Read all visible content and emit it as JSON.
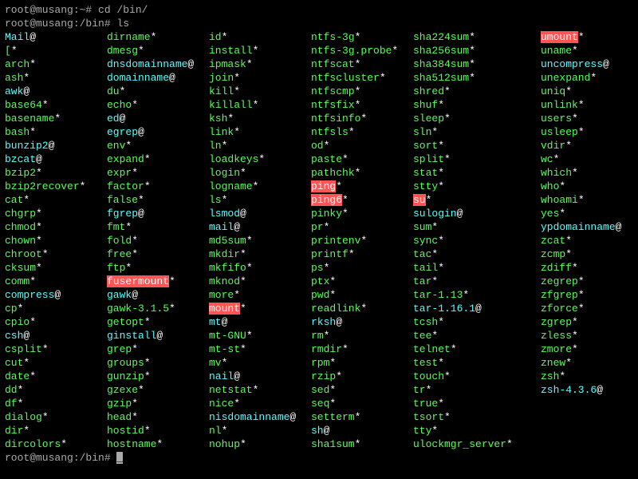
{
  "prompt1": "root@musang:~# ",
  "cmd1": "cd /bin/",
  "prompt2": "root@musang:/bin# ",
  "cmd2": "ls",
  "prompt3": "root@musang:/bin# ",
  "cursor": "_",
  "columns": [
    [
      {
        "name": "Mail",
        "suffix": "@",
        "style": "cyan"
      },
      {
        "name": "[",
        "suffix": "*",
        "style": "green"
      },
      {
        "name": "arch",
        "suffix": "*",
        "style": "green"
      },
      {
        "name": "ash",
        "suffix": "*",
        "style": "green"
      },
      {
        "name": "awk",
        "suffix": "@",
        "style": "cyan"
      },
      {
        "name": "base64",
        "suffix": "*",
        "style": "green"
      },
      {
        "name": "basename",
        "suffix": "*",
        "style": "green"
      },
      {
        "name": "bash",
        "suffix": "*",
        "style": "green"
      },
      {
        "name": "bunzip2",
        "suffix": "@",
        "style": "cyan"
      },
      {
        "name": "bzcat",
        "suffix": "@",
        "style": "cyan"
      },
      {
        "name": "bzip2",
        "suffix": "*",
        "style": "green"
      },
      {
        "name": "bzip2recover",
        "suffix": "*",
        "style": "green"
      },
      {
        "name": "cat",
        "suffix": "*",
        "style": "green"
      },
      {
        "name": "chgrp",
        "suffix": "*",
        "style": "green"
      },
      {
        "name": "chmod",
        "suffix": "*",
        "style": "green"
      },
      {
        "name": "chown",
        "suffix": "*",
        "style": "green"
      },
      {
        "name": "chroot",
        "suffix": "*",
        "style": "green"
      },
      {
        "name": "cksum",
        "suffix": "*",
        "style": "green"
      },
      {
        "name": "comm",
        "suffix": "*",
        "style": "green"
      },
      {
        "name": "compress",
        "suffix": "@",
        "style": "cyan"
      },
      {
        "name": "cp",
        "suffix": "*",
        "style": "green"
      },
      {
        "name": "cpio",
        "suffix": "*",
        "style": "green"
      },
      {
        "name": "csh",
        "suffix": "@",
        "style": "cyan"
      },
      {
        "name": "csplit",
        "suffix": "*",
        "style": "green"
      },
      {
        "name": "cut",
        "suffix": "*",
        "style": "green"
      },
      {
        "name": "date",
        "suffix": "*",
        "style": "green"
      },
      {
        "name": "dd",
        "suffix": "*",
        "style": "green"
      },
      {
        "name": "df",
        "suffix": "*",
        "style": "green"
      },
      {
        "name": "dialog",
        "suffix": "*",
        "style": "green"
      },
      {
        "name": "dir",
        "suffix": "*",
        "style": "green"
      },
      {
        "name": "dircolors",
        "suffix": "*",
        "style": "green"
      }
    ],
    [
      {
        "name": "dirname",
        "suffix": "*",
        "style": "green"
      },
      {
        "name": "dmesg",
        "suffix": "*",
        "style": "green"
      },
      {
        "name": "dnsdomainname",
        "suffix": "@",
        "style": "cyan"
      },
      {
        "name": "domainname",
        "suffix": "@",
        "style": "cyan"
      },
      {
        "name": "du",
        "suffix": "*",
        "style": "green"
      },
      {
        "name": "echo",
        "suffix": "*",
        "style": "green"
      },
      {
        "name": "ed",
        "suffix": "@",
        "style": "cyan"
      },
      {
        "name": "egrep",
        "suffix": "@",
        "style": "cyan"
      },
      {
        "name": "env",
        "suffix": "*",
        "style": "green"
      },
      {
        "name": "expand",
        "suffix": "*",
        "style": "green"
      },
      {
        "name": "expr",
        "suffix": "*",
        "style": "green"
      },
      {
        "name": "factor",
        "suffix": "*",
        "style": "green"
      },
      {
        "name": "false",
        "suffix": "*",
        "style": "green"
      },
      {
        "name": "fgrep",
        "suffix": "@",
        "style": "cyan"
      },
      {
        "name": "fmt",
        "suffix": "*",
        "style": "green"
      },
      {
        "name": "fold",
        "suffix": "*",
        "style": "green"
      },
      {
        "name": "free",
        "suffix": "*",
        "style": "green"
      },
      {
        "name": "ftp",
        "suffix": "*",
        "style": "green"
      },
      {
        "name": "fusermount",
        "suffix": "*",
        "style": "redbg"
      },
      {
        "name": "gawk",
        "suffix": "@",
        "style": "cyan"
      },
      {
        "name": "gawk-3.1.5",
        "suffix": "*",
        "style": "green"
      },
      {
        "name": "getopt",
        "suffix": "*",
        "style": "green"
      },
      {
        "name": "ginstall",
        "suffix": "@",
        "style": "cyan"
      },
      {
        "name": "grep",
        "suffix": "*",
        "style": "green"
      },
      {
        "name": "groups",
        "suffix": "*",
        "style": "green"
      },
      {
        "name": "gunzip",
        "suffix": "*",
        "style": "green"
      },
      {
        "name": "gzexe",
        "suffix": "*",
        "style": "green"
      },
      {
        "name": "gzip",
        "suffix": "*",
        "style": "green"
      },
      {
        "name": "head",
        "suffix": "*",
        "style": "green"
      },
      {
        "name": "hostid",
        "suffix": "*",
        "style": "green"
      },
      {
        "name": "hostname",
        "suffix": "*",
        "style": "green"
      }
    ],
    [
      {
        "name": "id",
        "suffix": "*",
        "style": "green"
      },
      {
        "name": "install",
        "suffix": "*",
        "style": "green"
      },
      {
        "name": "ipmask",
        "suffix": "*",
        "style": "green"
      },
      {
        "name": "join",
        "suffix": "*",
        "style": "green"
      },
      {
        "name": "kill",
        "suffix": "*",
        "style": "green"
      },
      {
        "name": "killall",
        "suffix": "*",
        "style": "green"
      },
      {
        "name": "ksh",
        "suffix": "*",
        "style": "green"
      },
      {
        "name": "link",
        "suffix": "*",
        "style": "green"
      },
      {
        "name": "ln",
        "suffix": "*",
        "style": "green"
      },
      {
        "name": "loadkeys",
        "suffix": "*",
        "style": "green"
      },
      {
        "name": "login",
        "suffix": "*",
        "style": "green"
      },
      {
        "name": "logname",
        "suffix": "*",
        "style": "green"
      },
      {
        "name": "ls",
        "suffix": "*",
        "style": "green"
      },
      {
        "name": "lsmod",
        "suffix": "@",
        "style": "cyan"
      },
      {
        "name": "mail",
        "suffix": "@",
        "style": "cyan"
      },
      {
        "name": "md5sum",
        "suffix": "*",
        "style": "green"
      },
      {
        "name": "mkdir",
        "suffix": "*",
        "style": "green"
      },
      {
        "name": "mkfifo",
        "suffix": "*",
        "style": "green"
      },
      {
        "name": "mknod",
        "suffix": "*",
        "style": "green"
      },
      {
        "name": "more",
        "suffix": "*",
        "style": "green"
      },
      {
        "name": "mount",
        "suffix": "*",
        "style": "redbg"
      },
      {
        "name": "mt",
        "suffix": "@",
        "style": "cyan"
      },
      {
        "name": "mt-GNU",
        "suffix": "*",
        "style": "green"
      },
      {
        "name": "mt-st",
        "suffix": "*",
        "style": "green"
      },
      {
        "name": "mv",
        "suffix": "*",
        "style": "green"
      },
      {
        "name": "nail",
        "suffix": "@",
        "style": "cyan"
      },
      {
        "name": "netstat",
        "suffix": "*",
        "style": "green"
      },
      {
        "name": "nice",
        "suffix": "*",
        "style": "green"
      },
      {
        "name": "nisdomainname",
        "suffix": "@",
        "style": "cyan"
      },
      {
        "name": "nl",
        "suffix": "*",
        "style": "green"
      },
      {
        "name": "nohup",
        "suffix": "*",
        "style": "green"
      }
    ],
    [
      {
        "name": "ntfs-3g",
        "suffix": "*",
        "style": "green"
      },
      {
        "name": "ntfs-3g.probe",
        "suffix": "*",
        "style": "green"
      },
      {
        "name": "ntfscat",
        "suffix": "*",
        "style": "green"
      },
      {
        "name": "ntfscluster",
        "suffix": "*",
        "style": "green"
      },
      {
        "name": "ntfscmp",
        "suffix": "*",
        "style": "green"
      },
      {
        "name": "ntfsfix",
        "suffix": "*",
        "style": "green"
      },
      {
        "name": "ntfsinfo",
        "suffix": "*",
        "style": "green"
      },
      {
        "name": "ntfsls",
        "suffix": "*",
        "style": "green"
      },
      {
        "name": "od",
        "suffix": "*",
        "style": "green"
      },
      {
        "name": "paste",
        "suffix": "*",
        "style": "green"
      },
      {
        "name": "pathchk",
        "suffix": "*",
        "style": "green"
      },
      {
        "name": "ping",
        "suffix": "*",
        "style": "redbg"
      },
      {
        "name": "ping6",
        "suffix": "*",
        "style": "redbg"
      },
      {
        "name": "pinky",
        "suffix": "*",
        "style": "green"
      },
      {
        "name": "pr",
        "suffix": "*",
        "style": "green"
      },
      {
        "name": "printenv",
        "suffix": "*",
        "style": "green"
      },
      {
        "name": "printf",
        "suffix": "*",
        "style": "green"
      },
      {
        "name": "ps",
        "suffix": "*",
        "style": "green"
      },
      {
        "name": "ptx",
        "suffix": "*",
        "style": "green"
      },
      {
        "name": "pwd",
        "suffix": "*",
        "style": "green"
      },
      {
        "name": "readlink",
        "suffix": "*",
        "style": "green"
      },
      {
        "name": "rksh",
        "suffix": "@",
        "style": "cyan"
      },
      {
        "name": "rm",
        "suffix": "*",
        "style": "green"
      },
      {
        "name": "rmdir",
        "suffix": "*",
        "style": "green"
      },
      {
        "name": "rpm",
        "suffix": "*",
        "style": "green"
      },
      {
        "name": "rzip",
        "suffix": "*",
        "style": "green"
      },
      {
        "name": "sed",
        "suffix": "*",
        "style": "green"
      },
      {
        "name": "seq",
        "suffix": "*",
        "style": "green"
      },
      {
        "name": "setterm",
        "suffix": "*",
        "style": "green"
      },
      {
        "name": "sh",
        "suffix": "@",
        "style": "cyan"
      },
      {
        "name": "sha1sum",
        "suffix": "*",
        "style": "green"
      }
    ],
    [
      {
        "name": "sha224sum",
        "suffix": "*",
        "style": "green"
      },
      {
        "name": "sha256sum",
        "suffix": "*",
        "style": "green"
      },
      {
        "name": "sha384sum",
        "suffix": "*",
        "style": "green"
      },
      {
        "name": "sha512sum",
        "suffix": "*",
        "style": "green"
      },
      {
        "name": "shred",
        "suffix": "*",
        "style": "green"
      },
      {
        "name": "shuf",
        "suffix": "*",
        "style": "green"
      },
      {
        "name": "sleep",
        "suffix": "*",
        "style": "green"
      },
      {
        "name": "sln",
        "suffix": "*",
        "style": "green"
      },
      {
        "name": "sort",
        "suffix": "*",
        "style": "green"
      },
      {
        "name": "split",
        "suffix": "*",
        "style": "green"
      },
      {
        "name": "stat",
        "suffix": "*",
        "style": "green"
      },
      {
        "name": "stty",
        "suffix": "*",
        "style": "green"
      },
      {
        "name": "su",
        "suffix": "*",
        "style": "redbg"
      },
      {
        "name": "sulogin",
        "suffix": "@",
        "style": "cyan"
      },
      {
        "name": "sum",
        "suffix": "*",
        "style": "green"
      },
      {
        "name": "sync",
        "suffix": "*",
        "style": "green"
      },
      {
        "name": "tac",
        "suffix": "*",
        "style": "green"
      },
      {
        "name": "tail",
        "suffix": "*",
        "style": "green"
      },
      {
        "name": "tar",
        "suffix": "*",
        "style": "green"
      },
      {
        "name": "tar-1.13",
        "suffix": "*",
        "style": "green"
      },
      {
        "name": "tar-1.16.1",
        "suffix": "@",
        "style": "cyan"
      },
      {
        "name": "tcsh",
        "suffix": "*",
        "style": "green"
      },
      {
        "name": "tee",
        "suffix": "*",
        "style": "green"
      },
      {
        "name": "telnet",
        "suffix": "*",
        "style": "green"
      },
      {
        "name": "test",
        "suffix": "*",
        "style": "green"
      },
      {
        "name": "touch",
        "suffix": "*",
        "style": "green"
      },
      {
        "name": "tr",
        "suffix": "*",
        "style": "green"
      },
      {
        "name": "true",
        "suffix": "*",
        "style": "green"
      },
      {
        "name": "tsort",
        "suffix": "*",
        "style": "green"
      },
      {
        "name": "tty",
        "suffix": "*",
        "style": "green"
      },
      {
        "name": "ulockmgr_server",
        "suffix": "*",
        "style": "green"
      }
    ],
    [
      {
        "name": "umount",
        "suffix": "*",
        "style": "redbg"
      },
      {
        "name": "uname",
        "suffix": "*",
        "style": "green"
      },
      {
        "name": "uncompress",
        "suffix": "@",
        "style": "cyan"
      },
      {
        "name": "unexpand",
        "suffix": "*",
        "style": "green"
      },
      {
        "name": "uniq",
        "suffix": "*",
        "style": "green"
      },
      {
        "name": "unlink",
        "suffix": "*",
        "style": "green"
      },
      {
        "name": "users",
        "suffix": "*",
        "style": "green"
      },
      {
        "name": "usleep",
        "suffix": "*",
        "style": "green"
      },
      {
        "name": "vdir",
        "suffix": "*",
        "style": "green"
      },
      {
        "name": "wc",
        "suffix": "*",
        "style": "green"
      },
      {
        "name": "which",
        "suffix": "*",
        "style": "green"
      },
      {
        "name": "who",
        "suffix": "*",
        "style": "green"
      },
      {
        "name": "whoami",
        "suffix": "*",
        "style": "green"
      },
      {
        "name": "yes",
        "suffix": "*",
        "style": "green"
      },
      {
        "name": "ypdomainname",
        "suffix": "@",
        "style": "cyan"
      },
      {
        "name": "zcat",
        "suffix": "*",
        "style": "green"
      },
      {
        "name": "zcmp",
        "suffix": "*",
        "style": "green"
      },
      {
        "name": "zdiff",
        "suffix": "*",
        "style": "green"
      },
      {
        "name": "zegrep",
        "suffix": "*",
        "style": "green"
      },
      {
        "name": "zfgrep",
        "suffix": "*",
        "style": "green"
      },
      {
        "name": "zforce",
        "suffix": "*",
        "style": "green"
      },
      {
        "name": "zgrep",
        "suffix": "*",
        "style": "green"
      },
      {
        "name": "zless",
        "suffix": "*",
        "style": "green"
      },
      {
        "name": "zmore",
        "suffix": "*",
        "style": "green"
      },
      {
        "name": "znew",
        "suffix": "*",
        "style": "green"
      },
      {
        "name": "zsh",
        "suffix": "*",
        "style": "green"
      },
      {
        "name": "zsh-4.3.6",
        "suffix": "@",
        "style": "cyan"
      }
    ]
  ]
}
